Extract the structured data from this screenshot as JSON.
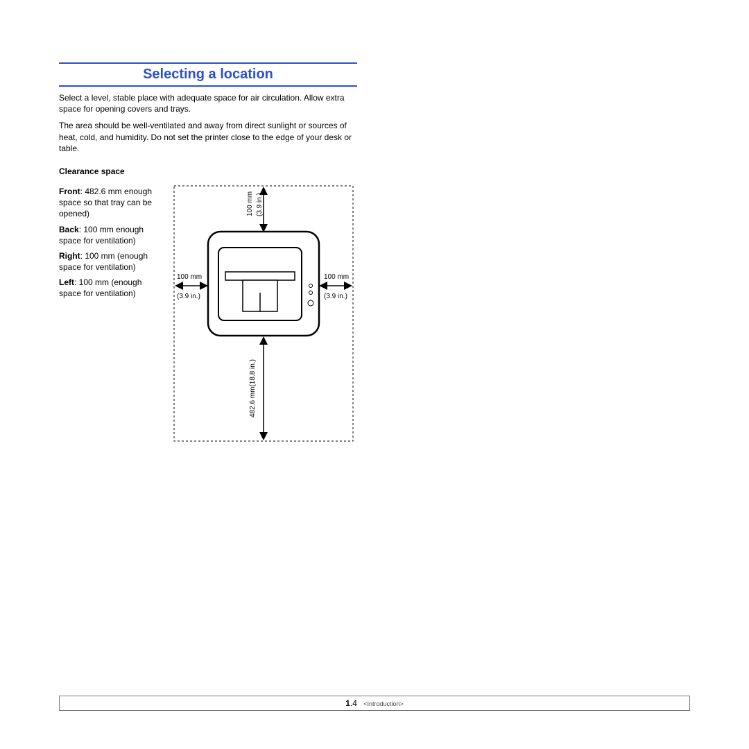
{
  "title": "Selecting a location",
  "para1": "Select a level, stable place with adequate space for air circulation. Allow extra space for opening covers and trays.",
  "para2": "The area should be well-ventilated and away from direct sunlight or sources of heat, cold, and humidity. Do not set the printer close to the edge of your desk or table.",
  "sub": "Clearance space",
  "clearance": {
    "front": {
      "label": "Front",
      "text": ": 482.6 mm enough space so that tray can be opened)"
    },
    "back": {
      "label": "Back",
      "text": ": 100 mm enough space for ventilation)"
    },
    "right": {
      "label": "Right",
      "text": ": 100 mm (enough space for ventilation)"
    },
    "left": {
      "label": "Left",
      "text": ": 100 mm (enough space for ventilation)"
    }
  },
  "diagram": {
    "top_mm": "100 mm",
    "top_in": "(3.9 in.)",
    "left_mm": "100 mm",
    "left_in": "(3.9 in.)",
    "right_mm": "100 mm",
    "right_in": "(3.9 in.)",
    "front_mm_in": "482.6 mm(18.8 in.)"
  },
  "footer": {
    "chapter": "1",
    "page": ".4",
    "crumb": "<Introduction>"
  }
}
